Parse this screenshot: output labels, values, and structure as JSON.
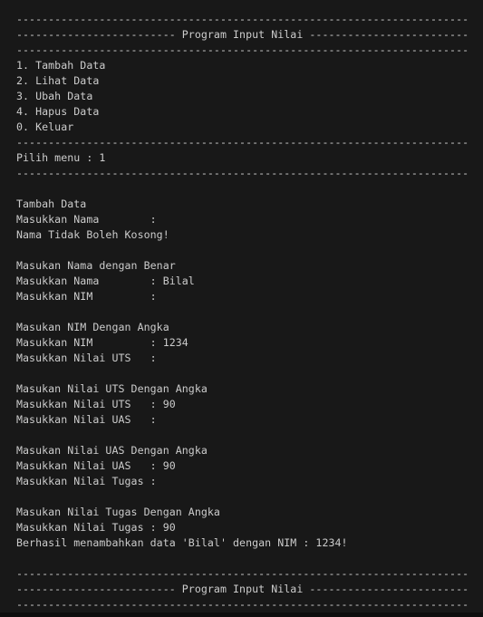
{
  "terminal": {
    "lines": [
      "-----------------------------------------------------------------------",
      "------------------------- Program Input Nilai -------------------------",
      "-----------------------------------------------------------------------",
      "1. Tambah Data",
      "2. Lihat Data",
      "3. Ubah Data",
      "4. Hapus Data",
      "0. Keluar",
      "-----------------------------------------------------------------------",
      "Pilih menu : 1",
      "-----------------------------------------------------------------------",
      "",
      "Tambah Data",
      "Masukkan Nama        :",
      "Nama Tidak Boleh Kosong!",
      "",
      "Masukan Nama dengan Benar",
      "Masukkan Nama        : Bilal",
      "Masukkan NIM         :",
      "",
      "Masukan NIM Dengan Angka",
      "Masukkan NIM         : 1234",
      "Masukkan Nilai UTS   :",
      "",
      "Masukan Nilai UTS Dengan Angka",
      "Masukkan Nilai UTS   : 90",
      "Masukkan Nilai UAS   :",
      "",
      "Masukan Nilai UAS Dengan Angka",
      "Masukkan Nilai UAS   : 90",
      "Masukkan Nilai Tugas :",
      "",
      "Masukan Nilai Tugas Dengan Angka",
      "Masukkan Nilai Tugas : 90",
      "Berhasil menambahkan data 'Bilal' dengan NIM : 1234!",
      "",
      "-----------------------------------------------------------------------",
      "------------------------- Program Input Nilai -------------------------",
      "-----------------------------------------------------------------------"
    ]
  }
}
